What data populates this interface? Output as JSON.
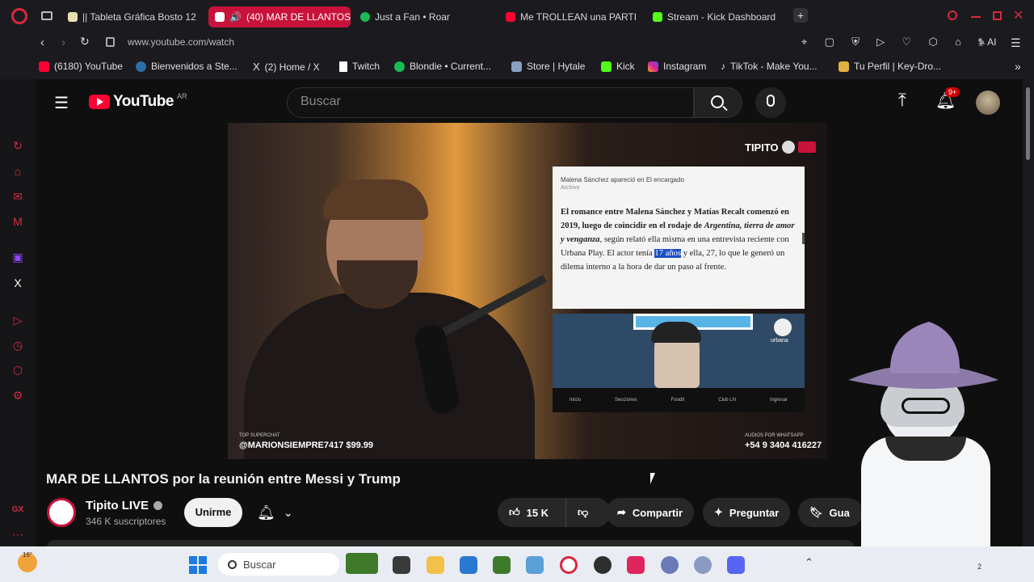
{
  "browser": {
    "tabs": [
      {
        "label": "|| Tableta Gráfica Bosto 12",
        "active": false
      },
      {
        "label": "(40) MAR DE LLANTOS",
        "active": true
      },
      {
        "label": "Just a Fan • Roar",
        "active": false
      },
      {
        "label": "Me TROLLEAN una PARTI",
        "active": false
      },
      {
        "label": "Stream - Kick Dashboard",
        "active": false
      }
    ],
    "new_tab": "+",
    "url": "www.youtube.com/watch",
    "ai_label": "AI",
    "bookmarks": [
      {
        "label": "(6180) YouTube",
        "icon": "youtube-icon"
      },
      {
        "label": "Bienvenidos a Ste...",
        "icon": "steam-icon"
      },
      {
        "label": "(2) Home / X",
        "icon": "x-icon"
      },
      {
        "label": "Twitch",
        "icon": "twitch-icon"
      },
      {
        "label": "Blondie • Current...",
        "icon": "spotify-icon"
      },
      {
        "label": "Store | Hytale",
        "icon": "hytale-icon"
      },
      {
        "label": "Kick",
        "icon": "kick-icon"
      },
      {
        "label": "Instagram",
        "icon": "instagram-icon"
      },
      {
        "label": "TikTok - Make You...",
        "icon": "tiktok-icon"
      },
      {
        "label": "Tu Perfil | Key-Dro...",
        "icon": "keydrop-icon"
      }
    ]
  },
  "youtube": {
    "logo_text": "YouTube",
    "region": "AR",
    "search_placeholder": "Buscar",
    "notifications_badge": "9+",
    "video": {
      "watermark": "TIPITO",
      "superchat_label": "TOP SUPERCHAT",
      "superchat": "@MARIONSIEMPRE7417 $99.99",
      "whatsapp_label": "AUDIOS POR WHATSAPP",
      "phone": "+54 9 3404 416227",
      "article": {
        "caption": "Malena Sánchez apareció en El encargado",
        "source": "Archivo",
        "bold_text": "El romance entre Malena Sánchez y Matías Recalt comenzó en 2019, luego de coincidir en el rodaje de",
        "italic_text": "Argentina, tierra de amor y venganza",
        "text_rest": ", según relató ella misma en una entrevista reciente con Urbana Play. El actor tenía",
        "highlight": "17 años",
        "text_end": "y ella, 27, lo que le generó un dilema interno a la hora de dar un paso al frente.",
        "img_badge": "urbana",
        "nav": [
          "Inicio",
          "Secciones",
          "Foodit",
          "Club LN",
          "Ingresar"
        ]
      }
    },
    "title": "MAR DE LLANTOS por la reunión entre Messi y Trump",
    "channel": {
      "name": "Tipito LIVE",
      "subscribers": "346 K suscriptores",
      "join_label": "Unirme"
    },
    "actions": {
      "likes": "15 K",
      "share": "Compartir",
      "ask": "Preguntar",
      "save": "Gua"
    }
  },
  "taskbar": {
    "weather": "16°",
    "search_placeholder": "Buscar"
  },
  "colors": {
    "accent": "#c8123a",
    "youtube_red": "#ff0033",
    "bg": "#0f0f0f"
  }
}
